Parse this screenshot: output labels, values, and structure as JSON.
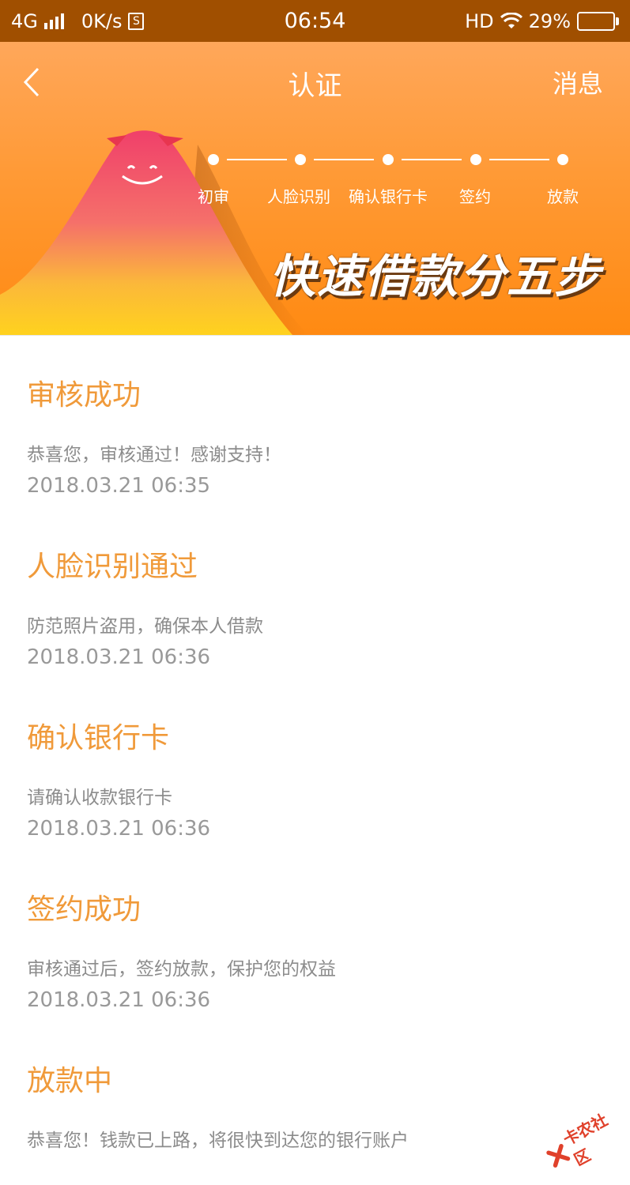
{
  "status_bar": {
    "network": "4G",
    "speed": "0K/s",
    "s_badge": "S",
    "time": "06:54",
    "hd": "HD",
    "battery_text": "29%",
    "battery_level": 0.29
  },
  "nav": {
    "title": "认证",
    "right_action": "消息"
  },
  "banner": {
    "steps": [
      "初审",
      "人脸识别",
      "确认银行卡",
      "签约",
      "放款"
    ],
    "slogan": "快速借款分五步"
  },
  "timeline": [
    {
      "title": "审核成功",
      "desc": "恭喜您，审核通过！感谢支持！",
      "time": "2018.03.21  06:35"
    },
    {
      "title": "人脸识别通过",
      "desc": "防范照片盗用，确保本人借款",
      "time": "2018.03.21  06:36"
    },
    {
      "title": "确认银行卡",
      "desc": "请确认收款银行卡",
      "time": "2018.03.21  06:36"
    },
    {
      "title": "签约成功",
      "desc": "审核通过后，签约放款，保护您的权益",
      "time": "2018.03.21  06:36"
    },
    {
      "title": "放款中",
      "desc": "恭喜您！钱款已上路，将很快到达您的银行账户",
      "time": ""
    }
  ],
  "watermark": "卡农社区",
  "colors": {
    "status_bar": "#a04f00",
    "banner": "#ff9a36",
    "title_orange": "#f09a3a",
    "text_gray": "#8c8c8c"
  }
}
